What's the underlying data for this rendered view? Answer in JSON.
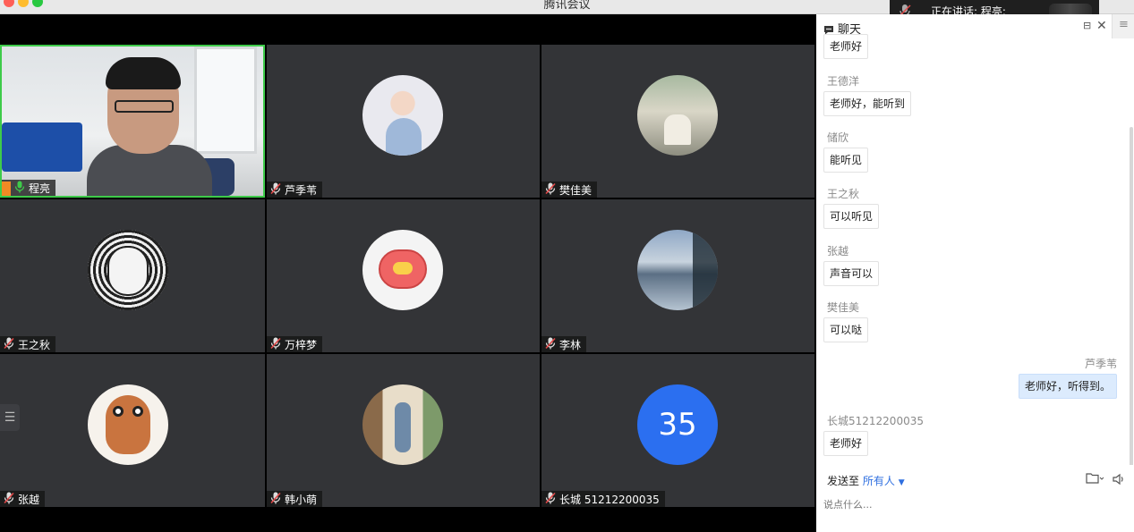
{
  "window": {
    "title": "腾讯会议"
  },
  "speaking": {
    "text": "正在讲话: 程亮;"
  },
  "participants": [
    {
      "name": "程亮"
    },
    {
      "name": "芦季苇"
    },
    {
      "name": "樊佳美"
    },
    {
      "name": "王之秋"
    },
    {
      "name": "万梓梦"
    },
    {
      "name": "李林"
    },
    {
      "name": "张越"
    },
    {
      "name": "韩小萌"
    },
    {
      "name": "长城 51212200035",
      "avatar_text": "35"
    }
  ],
  "chat": {
    "title": "聊天",
    "messages": [
      {
        "sender": "",
        "text": "老师好"
      },
      {
        "sender": "王德洋",
        "text": "老师好，能听到"
      },
      {
        "sender": "储欣",
        "text": "能听见"
      },
      {
        "sender": "王之秋",
        "text": "可以听见"
      },
      {
        "sender": "张越",
        "text": "声音可以"
      },
      {
        "sender": "樊佳美",
        "text": "可以哒"
      },
      {
        "sender": "芦季苇",
        "text": "老师好，听得到。"
      },
      {
        "sender": "长城51212200035",
        "text": "老师好"
      }
    ],
    "send_to_label": "发送至",
    "send_to_target": "所有人",
    "input_placeholder": "说点什么..."
  },
  "colors": {
    "active_border": "#3ecb4a",
    "accent": "#2f6fe0",
    "tile_bg": "#333437"
  }
}
